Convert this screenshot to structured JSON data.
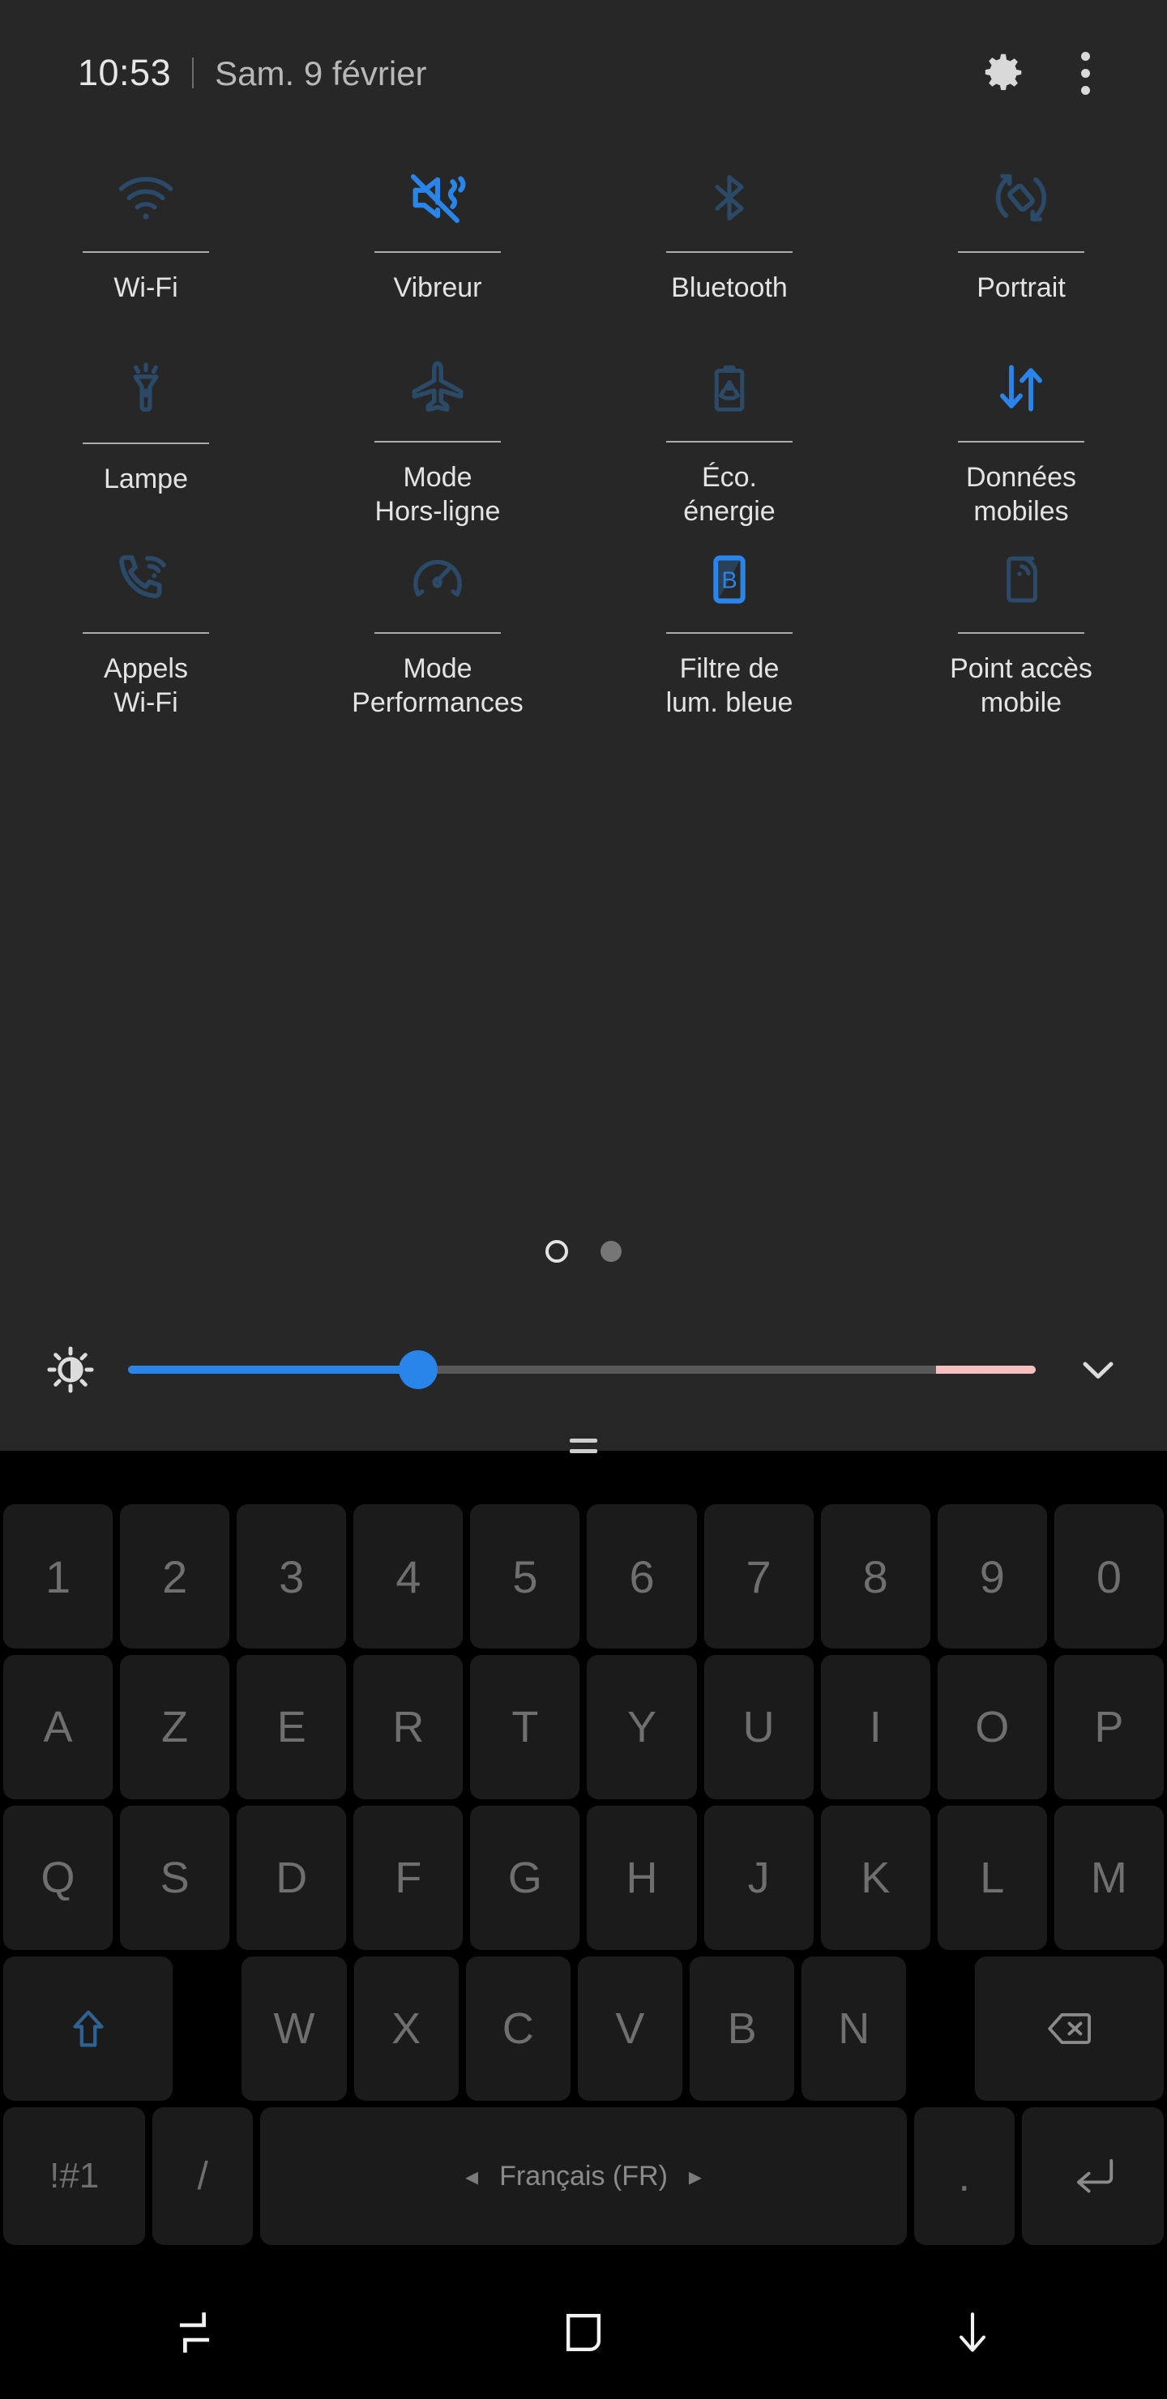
{
  "statusbar": {
    "time": "10:53",
    "date": "Sam. 9 février",
    "settings_icon": "gear-icon",
    "overflow_icon": "kebab-menu-icon"
  },
  "quick_settings": {
    "tiles": [
      {
        "label": "Wi-Fi",
        "icon": "wifi-icon",
        "active": false
      },
      {
        "label": "Vibreur",
        "icon": "vibrate-mute-icon",
        "active": true
      },
      {
        "label": "Bluetooth",
        "icon": "bluetooth-icon",
        "active": false
      },
      {
        "label": "Portrait",
        "icon": "auto-rotate-icon",
        "active": false
      },
      {
        "label": "Lampe",
        "icon": "flashlight-icon",
        "active": false
      },
      {
        "label": "Mode\nHors-ligne",
        "icon": "airplane-icon",
        "active": false
      },
      {
        "label": "Éco.\nénergie",
        "icon": "battery-eco-icon",
        "active": false
      },
      {
        "label": "Données\nmobiles",
        "icon": "mobile-data-icon",
        "active": true
      },
      {
        "label": "Appels\nWi-Fi",
        "icon": "wifi-calling-icon",
        "active": false
      },
      {
        "label": "Mode\nPerformances",
        "icon": "performance-icon",
        "active": false
      },
      {
        "label": "Filtre de\nlum. bleue",
        "icon": "blue-light-icon",
        "active": true
      },
      {
        "label": "Point accès\nmobile",
        "icon": "hotspot-icon",
        "active": false
      }
    ],
    "page_indicator": {
      "pages": 2,
      "current": 1
    },
    "expand_icon": "chevron-down-icon",
    "drag_handle_icon": "drag-handle-icon"
  },
  "brightness": {
    "icon": "brightness-icon",
    "value_percent": 32,
    "warn_zone_start_percent": 89,
    "fill_color": "#2a85ea",
    "track_color": "#595959",
    "warn_color": "#f6c0c0"
  },
  "keyboard": {
    "language": "Français (FR)",
    "prev_lang_arrow": "◂",
    "next_lang_arrow": "▸",
    "rows": {
      "numbers": [
        "1",
        "2",
        "3",
        "4",
        "5",
        "6",
        "7",
        "8",
        "9",
        "0"
      ],
      "letters1": [
        "A",
        "Z",
        "E",
        "R",
        "T",
        "Y",
        "U",
        "I",
        "O",
        "P"
      ],
      "letters2": [
        "Q",
        "S",
        "D",
        "F",
        "G",
        "H",
        "J",
        "K",
        "L",
        "M"
      ],
      "letters3": [
        "W",
        "X",
        "C",
        "V",
        "B",
        "N"
      ]
    },
    "shift_label": "shift-icon",
    "backspace_label": "backspace-icon",
    "symbols_label": "!#1",
    "slash_label": "/",
    "period_label": ".",
    "enter_label": "enter-icon"
  },
  "navbar": {
    "recents_icon": "recents-icon",
    "home_icon": "home-icon",
    "back_icon": "hide-keyboard-icon"
  },
  "colors": {
    "panel_bg": "#272727",
    "accent_active": "#2a85ea",
    "accent_inactive": "#2b4a68",
    "label_text": "#e3e3e3",
    "key_bg": "#1b1b1b",
    "key_text": "#6f6f6f"
  }
}
